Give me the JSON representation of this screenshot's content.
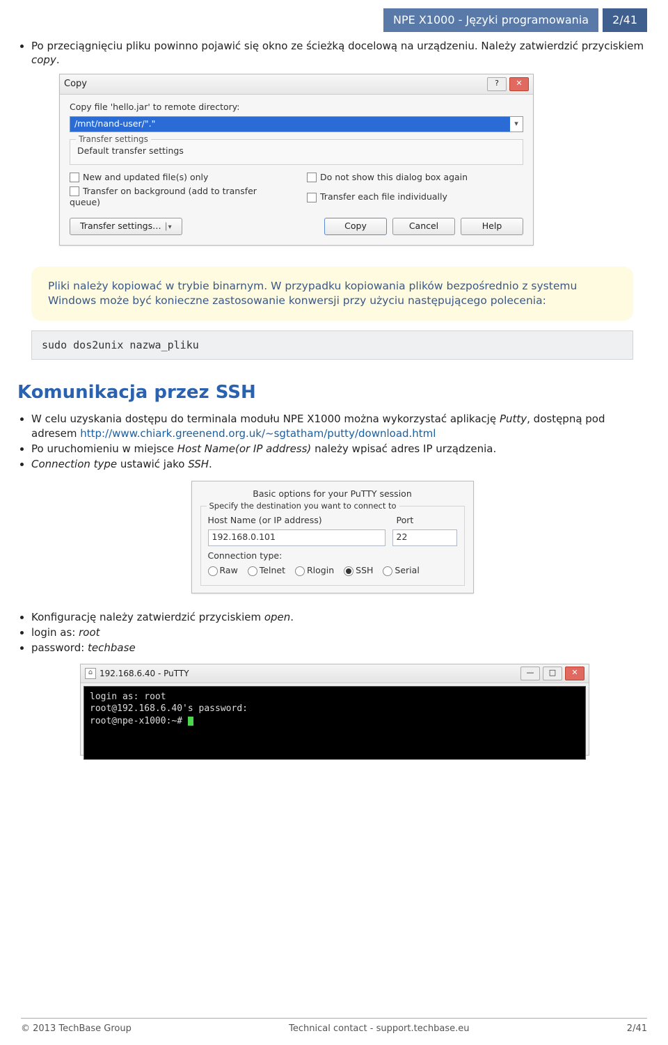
{
  "header": {
    "title": "NPE X1000 - Języki programowania",
    "page": "2/41"
  },
  "intro_li_prefix": "Po przeciągnięciu pliku powinno pojawić się okno ze ścieżką docelową na urządzeniu. Należy zatwierdzić przyciskiem ",
  "intro_li_em": "copy",
  "copy_dlg": {
    "title": "Copy",
    "help_btn": "?",
    "close_btn": "✕",
    "prompt": "Copy file 'hello.jar' to remote directory:",
    "path": "/mnt/nand-user/\".\"",
    "transfer_group": "Transfer settings",
    "transfer_default": "Default transfer settings",
    "opt1": "New and updated file(s) only",
    "opt2": "Do not show this dialog box again",
    "opt3": "Transfer on background (add to transfer queue)",
    "opt4": "Transfer each file individually",
    "btn_settings": "Transfer settings…",
    "btn_copy": "Copy",
    "btn_cancel": "Cancel",
    "btn_help": "Help"
  },
  "note": "Pliki należy kopiować w trybie binarnym. W przypadku kopiowania plików bezpośrednio z systemu Windows może być konieczne zastosowanie konwersji przy użyciu następującego polecenia:",
  "code": "sudo dos2unix nazwa_pliku",
  "section_title": "Komunikacja przez SSH",
  "ssh_li1a": "W celu uzyskania dostępu do terminala modułu NPE X1000 można wykorzystać aplikację ",
  "ssh_li1_em": "Putty",
  "ssh_li1b": ", dostępną pod adresem ",
  "ssh_link": "http://www.chiark.greenend.org.uk/~sgtatham/putty/download.html",
  "ssh_li2a": "Po uruchomieniu w miejsce ",
  "ssh_li2_em": "Host Name(or IP address)",
  "ssh_li2b": " należy wpisać adres IP urządzenia.",
  "ssh_li3_em": "Connection type",
  "ssh_li3b": " ustawić jako ",
  "ssh_li3_em2": "SSH",
  "putty": {
    "title": "Basic options for your PuTTY session",
    "group": "Specify the destination you want to connect to",
    "host_lbl": "Host Name (or IP address)",
    "port_lbl": "Port",
    "host_val": "192.168.0.101",
    "port_val": "22",
    "conn_lbl": "Connection type:",
    "r_raw": "Raw",
    "r_telnet": "Telnet",
    "r_rlogin": "Rlogin",
    "r_ssh": "SSH",
    "r_serial": "Serial"
  },
  "post_li1a": "Konfigurację należy zatwierdzić przyciskiem ",
  "post_li1_em": "open",
  "post_li2a": "login as: ",
  "post_li2_em": "root",
  "post_li3a": "password: ",
  "post_li3_em": "techbase",
  "term": {
    "title": "192.168.6.40 - PuTTY",
    "l1": "login as: root",
    "l2": "root@192.168.6.40's password:",
    "l3": "root@npe-x1000:~#"
  },
  "footer": {
    "left": "© 2013 TechBase Group",
    "center": "Technical contact - support.techbase.eu",
    "right": "2/41"
  }
}
